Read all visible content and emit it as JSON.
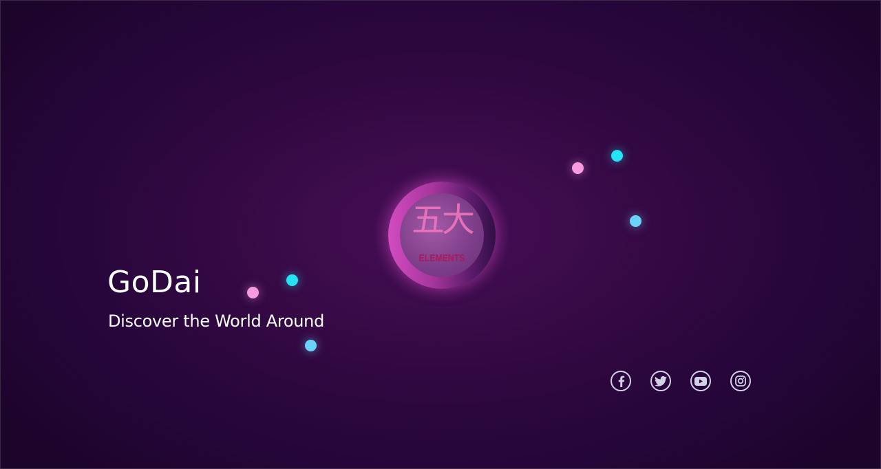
{
  "hero": {
    "title": "GoDai",
    "subtitle": "Discover the World Around"
  },
  "logo": {
    "kanji": "五大",
    "caption": "ELEMENTS"
  },
  "socials": [
    {
      "name": "facebook-icon"
    },
    {
      "name": "twitter-icon"
    },
    {
      "name": "youtube-icon"
    },
    {
      "name": "instagram-icon"
    }
  ],
  "colors": {
    "background": "#2e0840",
    "dot_pink": "#f79be0",
    "dot_cyan": "#25e3f3",
    "dot_sky": "#6bd3fa",
    "logo_accent": "#d24bc0",
    "icon": "#d2d2e6"
  }
}
